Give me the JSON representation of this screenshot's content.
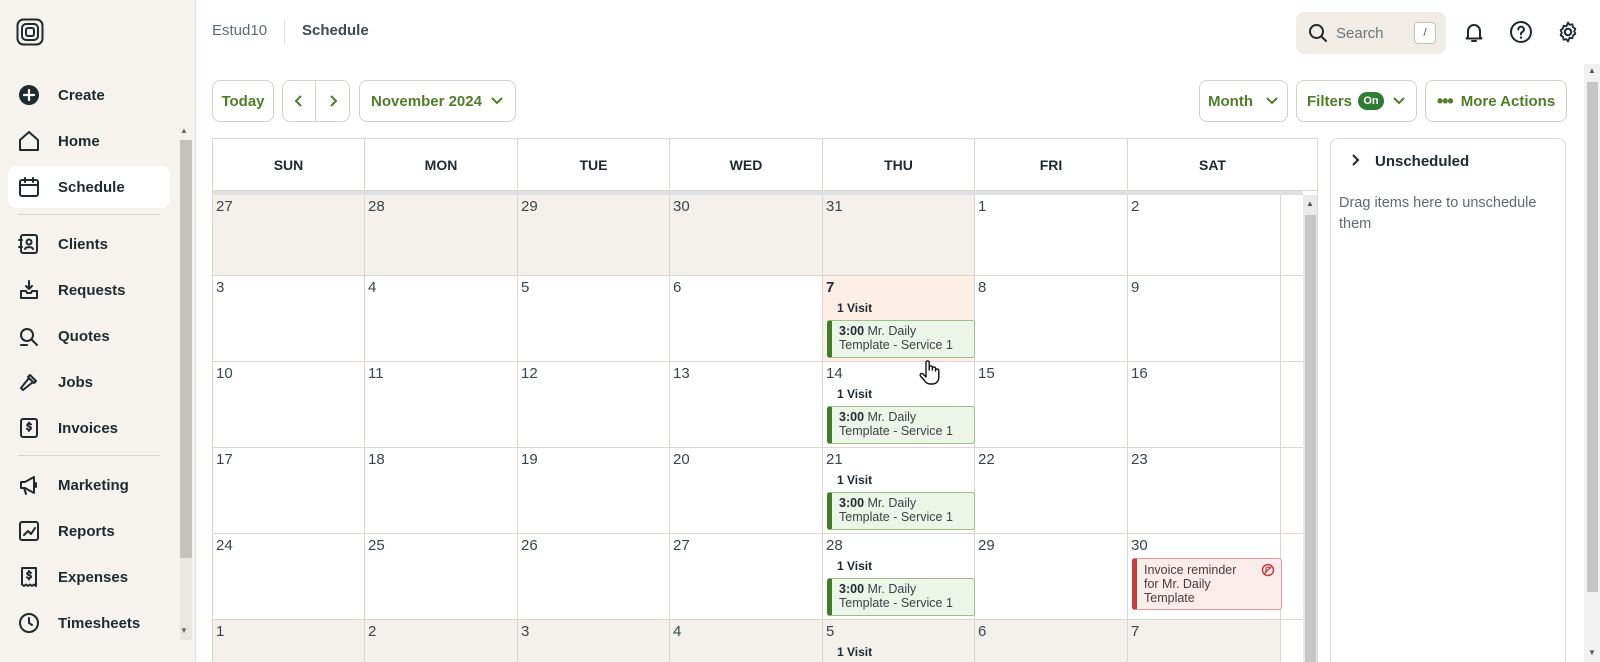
{
  "app": {
    "org": "Estud10",
    "page": "Schedule"
  },
  "sidebar": {
    "groups": [
      [
        {
          "label": "Create",
          "icon": "plus-circle-icon"
        },
        {
          "label": "Home",
          "icon": "home-icon"
        },
        {
          "label": "Schedule",
          "icon": "calendar-icon",
          "active": true
        }
      ],
      [
        {
          "label": "Clients",
          "icon": "clients-icon"
        },
        {
          "label": "Requests",
          "icon": "requests-icon"
        },
        {
          "label": "Quotes",
          "icon": "quotes-icon"
        },
        {
          "label": "Jobs",
          "icon": "hammer-icon"
        },
        {
          "label": "Invoices",
          "icon": "invoice-icon"
        }
      ],
      [
        {
          "label": "Marketing",
          "icon": "megaphone-icon"
        },
        {
          "label": "Reports",
          "icon": "reports-icon"
        },
        {
          "label": "Expenses",
          "icon": "expenses-icon"
        },
        {
          "label": "Timesheets",
          "icon": "clock-icon"
        }
      ]
    ]
  },
  "header": {
    "search_placeholder": "Search",
    "search_shortcut": "/"
  },
  "toolbar": {
    "today": "Today",
    "period": "November 2024",
    "view": "Month",
    "filters": "Filters",
    "filters_state": "On",
    "more_actions": "More Actions"
  },
  "calendar": {
    "weekdays": [
      "SUN",
      "MON",
      "TUE",
      "WED",
      "THU",
      "FRI",
      "SAT"
    ],
    "weeks": [
      [
        {
          "n": "27",
          "out": true
        },
        {
          "n": "28",
          "out": true
        },
        {
          "n": "29",
          "out": true
        },
        {
          "n": "30",
          "out": true
        },
        {
          "n": "31",
          "out": true
        },
        {
          "n": "1"
        },
        {
          "n": "2"
        }
      ],
      [
        {
          "n": "3"
        },
        {
          "n": "4"
        },
        {
          "n": "5"
        },
        {
          "n": "6"
        },
        {
          "n": "7",
          "today": true,
          "visits": "1 Visit",
          "event": {
            "time": "3:00",
            "title": "Mr. Daily",
            "line2": "Template - Service 1"
          }
        },
        {
          "n": "8"
        },
        {
          "n": "9"
        }
      ],
      [
        {
          "n": "10"
        },
        {
          "n": "11"
        },
        {
          "n": "12"
        },
        {
          "n": "13"
        },
        {
          "n": "14",
          "visits": "1 Visit",
          "event": {
            "time": "3:00",
            "title": "Mr. Daily",
            "line2": "Template - Service 1"
          }
        },
        {
          "n": "15"
        },
        {
          "n": "16"
        }
      ],
      [
        {
          "n": "17"
        },
        {
          "n": "18"
        },
        {
          "n": "19"
        },
        {
          "n": "20"
        },
        {
          "n": "21",
          "visits": "1 Visit",
          "event": {
            "time": "3:00",
            "title": "Mr. Daily",
            "line2": "Template - Service 1"
          }
        },
        {
          "n": "22"
        },
        {
          "n": "23"
        }
      ],
      [
        {
          "n": "24"
        },
        {
          "n": "25"
        },
        {
          "n": "26"
        },
        {
          "n": "27"
        },
        {
          "n": "28",
          "visits": "1 Visit",
          "event": {
            "time": "3:00",
            "title": "Mr. Daily",
            "line2": "Template - Service 1"
          }
        },
        {
          "n": "29"
        },
        {
          "n": "30",
          "reminder": [
            "Invoice reminder",
            "for Mr. Daily",
            "Template"
          ]
        }
      ],
      [
        {
          "n": "1",
          "out": true
        },
        {
          "n": "2",
          "out": true
        },
        {
          "n": "3",
          "out": true
        },
        {
          "n": "4",
          "out": true
        },
        {
          "n": "5",
          "out": true,
          "visits": "1 Visit"
        },
        {
          "n": "6",
          "out": true
        },
        {
          "n": "7",
          "out": true
        }
      ]
    ]
  },
  "unscheduled": {
    "title": "Unscheduled",
    "description": "Drag items here to unschedule them"
  },
  "colors": {
    "accent": "#4f7e2a",
    "visit_border": "#3f7d28",
    "reminder_border": "#c43b3b",
    "today_bg": "#fdeee6"
  }
}
